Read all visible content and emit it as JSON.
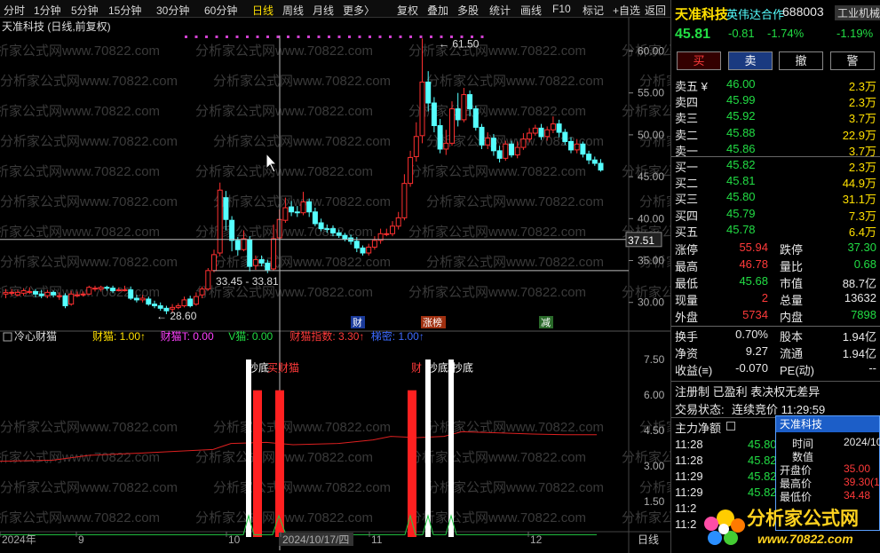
{
  "toolbar": {
    "periods": [
      "分时",
      "1分钟",
      "5分钟",
      "15分钟",
      "30分钟",
      "60分钟",
      "日线",
      "周线",
      "月线",
      "更多〉"
    ],
    "active": "日线",
    "tools": [
      "复权",
      "叠加",
      "多股",
      "统计",
      "画线",
      "F10",
      "标记",
      "+自选",
      "返回"
    ]
  },
  "chart": {
    "title": "天准科技 (日线,前复权)",
    "y_ticks": [
      "60.00",
      "55.00",
      "50.00",
      "45.00",
      "40.00",
      "35.00",
      "30.00"
    ],
    "crosshair_price": "37.51",
    "high_label": "61.50",
    "low_label": "28.60",
    "range_label": "33.45 - 33.81",
    "event_labels": [
      "财",
      "涨榜",
      "减"
    ],
    "x_labels": [
      "2024年",
      "9",
      "10",
      "2024/10/17/四",
      "11",
      "12"
    ],
    "period_label": "日线",
    "candles": [
      [
        31,
        31.2,
        30.5,
        31.6
      ],
      [
        31.2,
        31.2,
        30.8,
        31.6
      ],
      [
        30.9,
        31.2,
        30.7,
        31.5
      ],
      [
        31.1,
        31.4,
        30.8,
        31.7
      ],
      [
        31.3,
        31.3,
        31,
        31.8
      ],
      [
        31.3,
        31,
        30.6,
        31.6
      ],
      [
        31,
        30.8,
        30.5,
        31.5
      ],
      [
        30.8,
        31.2,
        30.5,
        31.5
      ],
      [
        31.2,
        30.9,
        30.6,
        31.4
      ],
      [
        30.8,
        30.8,
        30.3,
        31.2
      ],
      [
        30.8,
        29.6,
        29.3,
        31.1
      ],
      [
        29.8,
        31,
        29.6,
        31.4
      ],
      [
        30.9,
        30.9,
        30.6,
        31.3
      ],
      [
        31,
        31,
        30.7,
        31.3
      ],
      [
        31,
        31.8,
        30.9,
        32
      ],
      [
        31.7,
        31.7,
        31.3,
        32
      ],
      [
        31.6,
        31.8,
        31.3,
        32
      ],
      [
        31.8,
        31.7,
        31.4,
        32
      ],
      [
        31.7,
        31.4,
        31.1,
        32
      ],
      [
        31.5,
        31.5,
        31.3,
        31.8
      ],
      [
        31.5,
        31.5,
        31.3,
        32
      ],
      [
        31.5,
        30.5,
        30.3,
        31.9
      ],
      [
        30.5,
        30.3,
        30,
        30.9
      ],
      [
        30.3,
        30.5,
        30,
        30.9
      ],
      [
        30.4,
        29.8,
        29.6,
        30.7
      ],
      [
        29.8,
        29.6,
        29.3,
        30.2
      ],
      [
        29.6,
        29.3,
        29,
        30
      ],
      [
        29.3,
        29,
        28.6,
        29.6
      ],
      [
        29.2,
        29.4,
        28.8,
        29.8
      ],
      [
        29.4,
        29.6,
        29.2,
        29.9
      ],
      [
        29.6,
        30.3,
        29.4,
        30.7
      ],
      [
        30.4,
        29.6,
        29.4,
        30.8
      ],
      [
        29.8,
        30.7,
        29.6,
        31.2
      ],
      [
        30.9,
        31.6,
        30.5,
        31.9
      ],
      [
        31.6,
        33.8,
        31.4,
        34.1
      ],
      [
        33.8,
        35.7,
        33.6,
        36.3
      ],
      [
        35.9,
        43.4,
        35.5,
        44.3
      ],
      [
        42.5,
        39.9,
        38.6,
        43.3
      ],
      [
        39.8,
        37.4,
        36.1,
        40.3
      ],
      [
        37.4,
        36.3,
        35.6,
        37.8
      ],
      [
        36.3,
        37.6,
        36.1,
        38.6
      ],
      [
        37.5,
        34.3,
        33.7,
        37.9
      ],
      [
        34.4,
        35.1,
        33.9,
        35.6
      ],
      [
        35.1,
        34.7,
        34.3,
        35.6
      ],
      [
        34.7,
        33.9,
        33.5,
        35.1
      ],
      [
        34,
        37.6,
        33.8,
        39.3
      ],
      [
        37.7,
        39.9,
        37.4,
        41.1
      ],
      [
        39.8,
        41.3,
        39.5,
        42.5
      ],
      [
        41.4,
        40.8,
        40.3,
        42.1
      ],
      [
        40.8,
        40.7,
        40.2,
        41.5
      ],
      [
        40.7,
        42,
        40.4,
        43.2
      ],
      [
        42,
        40.8,
        40.2,
        42.4
      ],
      [
        40.8,
        39.4,
        39.1,
        41.3
      ],
      [
        39.5,
        38.8,
        38.5,
        40
      ],
      [
        38.8,
        38.7,
        38.3,
        39.3
      ],
      [
        38.8,
        38.3,
        37.9,
        39.2
      ],
      [
        38.3,
        38,
        37.7,
        38.7
      ],
      [
        38,
        37.6,
        37.3,
        38.3
      ],
      [
        37.7,
        37.3,
        36.9,
        38.1
      ],
      [
        37.3,
        36.5,
        36,
        37.8
      ],
      [
        36.5,
        35.9,
        35.6,
        36.8
      ],
      [
        35.9,
        36.6,
        35.6,
        37
      ],
      [
        36.6,
        37.4,
        36.3,
        37.9
      ],
      [
        37.4,
        38.2,
        37,
        38.8
      ],
      [
        38.2,
        38.2,
        37.9,
        38.8
      ],
      [
        38.2,
        39.1,
        37.9,
        39.7
      ],
      [
        39.1,
        40.1,
        38.7,
        40.8
      ],
      [
        40.1,
        44.2,
        39.8,
        45.3
      ],
      [
        44.2,
        47.3,
        43.8,
        48.1
      ],
      [
        47.4,
        49.8,
        46.8,
        51.5
      ],
      [
        49.9,
        56.3,
        49,
        61.5
      ],
      [
        56.3,
        53.8,
        52.8,
        57.6
      ],
      [
        53.8,
        51.1,
        50.3,
        54.5
      ],
      [
        51.1,
        48.3,
        47.8,
        51.9
      ],
      [
        48.3,
        49,
        47.6,
        50.6
      ],
      [
        49,
        53.1,
        48.7,
        54
      ],
      [
        53.1,
        51.8,
        51,
        55
      ],
      [
        51.8,
        54.8,
        51.5,
        55.6
      ],
      [
        54.8,
        53.1,
        52.2,
        55.3
      ],
      [
        53.1,
        50.9,
        50.5,
        53.5
      ],
      [
        50.9,
        48.8,
        48.3,
        51.3
      ],
      [
        48.8,
        49.6,
        48.3,
        50.3
      ],
      [
        49.6,
        48.1,
        47.5,
        50.1
      ],
      [
        48.1,
        47.2,
        46.7,
        48.7
      ],
      [
        47.2,
        48.9,
        46.9,
        49.3
      ],
      [
        48.9,
        47.6,
        47.3,
        49.3
      ],
      [
        47.6,
        48.5,
        47.2,
        49.2
      ],
      [
        48.5,
        49.5,
        48.2,
        50.2
      ],
      [
        49.5,
        50.2,
        49.1,
        50.8
      ],
      [
        50.2,
        50.8,
        49.9,
        51.2
      ],
      [
        50.8,
        49.8,
        49.4,
        51.3
      ],
      [
        49.8,
        50.6,
        49.3,
        51
      ],
      [
        50.6,
        51.3,
        50.2,
        52.2
      ],
      [
        51.3,
        50.3,
        49.7,
        51.8
      ],
      [
        50.3,
        49.2,
        48.8,
        50.7
      ],
      [
        49.2,
        48.2,
        47.8,
        49.7
      ],
      [
        48.2,
        48.9,
        47.8,
        49.5
      ],
      [
        48.9,
        47.7,
        47.3,
        49.2
      ],
      [
        47.7,
        47,
        46.5,
        48.1
      ],
      [
        47,
        46.6,
        46.3,
        47.4
      ],
      [
        46.6,
        45.8,
        45.6,
        47.1
      ]
    ]
  },
  "indicator": {
    "name": "冷心财猫",
    "values": [
      {
        "label": "财猫: 1.00↑",
        "color": "#ffe000"
      },
      {
        "label": "财猫T: 0.00",
        "color": "#ff40ff"
      },
      {
        "label": "V猫: 0.00",
        "color": "#22dd44"
      },
      {
        "label": "财猫指数: 3.30↑",
        "color": "#ff3a3a"
      },
      {
        "label": "梯密: 1.00↑",
        "color": "#3d6bff"
      }
    ],
    "y_ticks": [
      "7.50",
      "6.00",
      "4.50",
      "3.00",
      "1.50"
    ],
    "signal_labels": [
      {
        "text": "抄底",
        "color": "#fff"
      },
      {
        "text": "买财猫",
        "color": "#ff3a3a"
      },
      {
        "text": "财",
        "color": "#ff3a3a"
      },
      {
        "text": "抄底",
        "color": "#fff"
      },
      {
        "text": "抄底",
        "color": "#fff"
      }
    ]
  },
  "quote": {
    "name": "天准科技",
    "partner": "英伟达合作",
    "code": "688003",
    "industry": "工业机械",
    "price": "45.81",
    "change": "-0.81",
    "pct": "-1.74%",
    "industry_pct": "-1.19%",
    "buttons": [
      "买",
      "卖",
      "撤",
      "警"
    ],
    "asks": [
      {
        "label": "卖五 ¥",
        "price": "46.00",
        "vol": "2.3万"
      },
      {
        "label": "卖四",
        "price": "45.99",
        "vol": "2.3万"
      },
      {
        "label": "卖三",
        "price": "45.92",
        "vol": "3.7万"
      },
      {
        "label": "卖二",
        "price": "45.88",
        "vol": "22.9万"
      },
      {
        "label": "卖一",
        "price": "45.86",
        "vol": "3.7万"
      }
    ],
    "bids": [
      {
        "label": "买一",
        "price": "45.82",
        "vol": "2.3万"
      },
      {
        "label": "买二",
        "price": "45.81",
        "vol": "44.9万"
      },
      {
        "label": "买三",
        "price": "45.80",
        "vol": "31.1万"
      },
      {
        "label": "买四",
        "price": "45.79",
        "vol": "7.3万"
      },
      {
        "label": "买五",
        "price": "45.78",
        "vol": "6.4万"
      }
    ],
    "stats": [
      {
        "l": "涨停",
        "v": "55.94",
        "r": "跌停",
        "rv": "37.30"
      },
      {
        "l": "最高",
        "v": "46.78",
        "r": "量比",
        "rv": "0.68"
      },
      {
        "l": "最低",
        "v": "45.68",
        "r": "市值",
        "rv": "88.7亿"
      },
      {
        "l": "现量",
        "v": "2",
        "r": "总量",
        "rv": "13632"
      },
      {
        "l": "外盘",
        "v": "5734",
        "r": "内盘",
        "rv": "7898"
      }
    ],
    "stats2": [
      {
        "l": "换手",
        "v": "0.70%",
        "r": "股本",
        "rv": "1.94亿"
      },
      {
        "l": "净资",
        "v": "9.27",
        "r": "流通",
        "rv": "1.94亿"
      },
      {
        "l": "收益(≡)",
        "v": "-0.070",
        "r": "PE(动)",
        "rv": "--"
      }
    ],
    "tags": "注册制 已盈利 表决权无差异",
    "status_label": "交易状态:",
    "status": "连续竞价 11:29:59",
    "flow_label": "主力净额",
    "ticks": [
      {
        "t": "11:28",
        "p": "45.80"
      },
      {
        "t": "11:28",
        "p": "45.82"
      },
      {
        "t": "11:29",
        "p": "45.82"
      },
      {
        "t": "11:29",
        "p": "45.82"
      },
      {
        "t": "11:2",
        "p": ""
      },
      {
        "t": "11:2",
        "p": ""
      }
    ]
  },
  "popup": {
    "title": "天准科技",
    "rows": [
      {
        "l": "时间",
        "v": "2024/10"
      },
      {
        "l": "数值",
        "v": ""
      },
      {
        "l": "开盘价",
        "v": "35.00"
      },
      {
        "l": "最高价",
        "v": "39.30(1"
      },
      {
        "l": "最低价",
        "v": "34.48"
      }
    ]
  },
  "watermark": "分析家公式网www.70822.com",
  "logo": {
    "text": "分析家公式网",
    "url": "www.70822.com"
  }
}
